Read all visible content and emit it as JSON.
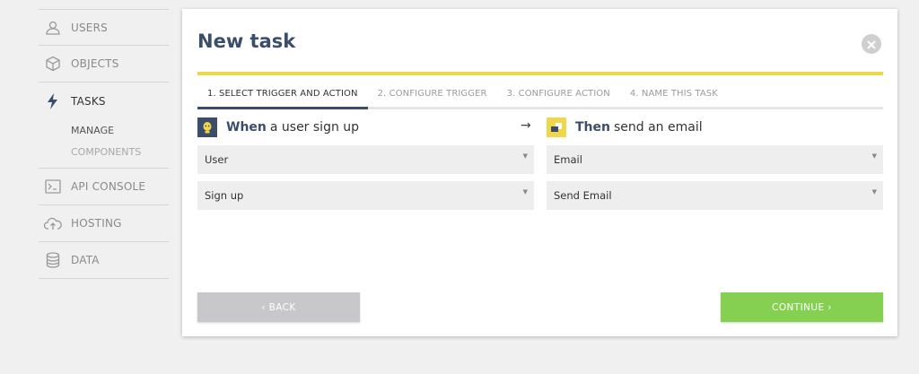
{
  "sidebar": {
    "items": [
      {
        "label": "USERS",
        "icon": "user-icon"
      },
      {
        "label": "OBJECTS",
        "icon": "cube-icon"
      },
      {
        "label": "TASKS",
        "icon": "lightning-icon"
      },
      {
        "label": "API CONSOLE",
        "icon": "terminal-icon"
      },
      {
        "label": "HOSTING",
        "icon": "cloud-upload-icon"
      },
      {
        "label": "DATA",
        "icon": "database-icon"
      }
    ],
    "tasks_sub": [
      "MANAGE",
      "COMPONENTS"
    ]
  },
  "modal": {
    "title": "New task",
    "steps": [
      "1. SELECT TRIGGER AND ACTION",
      "2. CONFIGURE TRIGGER",
      "3. CONFIGURE ACTION",
      "4. NAME THIS TASK"
    ],
    "trigger": {
      "strong": "When",
      "text": "a user sign up",
      "entity": "User",
      "event": "Sign up"
    },
    "arrow": "→",
    "action": {
      "strong": "Then",
      "text": "send an email",
      "service": "Email",
      "event": "Send Email"
    },
    "back_label": "‹  BACK",
    "continue_label": "CONTINUE  ›"
  },
  "colors": {
    "accent_yellow": "#ecd84a",
    "navy": "#3a4d6a",
    "continue_green": "#86d051",
    "back_gray": "#c8c8ca"
  }
}
